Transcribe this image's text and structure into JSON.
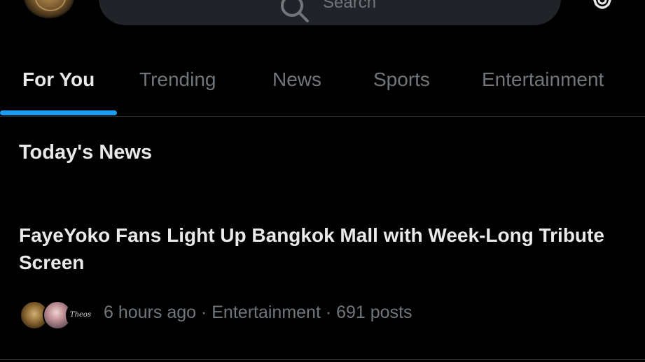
{
  "search": {
    "placeholder": "Search"
  },
  "tabs": [
    {
      "label": "For You",
      "active": true
    },
    {
      "label": "Trending",
      "active": false
    },
    {
      "label": "News",
      "active": false
    },
    {
      "label": "Sports",
      "active": false
    },
    {
      "label": "Entertainment",
      "active": false
    }
  ],
  "section": {
    "title": "Today's News"
  },
  "news": [
    {
      "headline": "FayeYoko Fans Light Up Bangkok Mall with Week-Long Tribute Screen",
      "avatar_caption": "Theos",
      "meta": "6 hours ago · Entertainment · 691 posts"
    }
  ],
  "colors": {
    "background": "#000000",
    "accent": "#1d9bf0",
    "text_primary": "#e7e9ea",
    "text_secondary": "#71767b",
    "divider": "#2f3336"
  },
  "icons": {
    "search": "search-icon",
    "settings": "gear-icon"
  }
}
